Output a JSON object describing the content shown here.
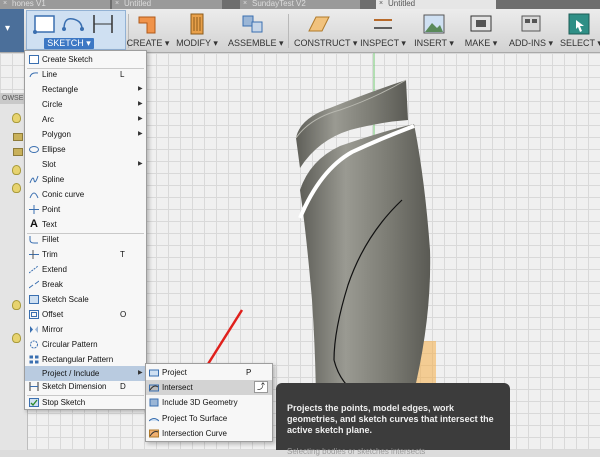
{
  "tabs": [
    {
      "label": "hones V1",
      "active": false
    },
    {
      "label": "Untitled",
      "active": false
    },
    {
      "label": "SundayTest V2",
      "active": false
    },
    {
      "label": "Untitled",
      "active": true
    }
  ],
  "toolbar": {
    "sketch": "SKETCH ▾",
    "create": "CREATE ▾",
    "modify": "MODIFY ▾",
    "assemble": "ASSEMBLE ▾",
    "construct": "CONSTRUCT ▾",
    "inspect": "INSPECT ▾",
    "insert": "INSERT ▾",
    "make": "MAKE ▾",
    "addins": "ADD-INS ▾",
    "select": "SELECT ▾"
  },
  "browser": {
    "header": "OWSER"
  },
  "sketch_menu": [
    {
      "label": "Create Sketch",
      "icon": "create-sketch-icon",
      "shortcut": ""
    },
    {
      "label": "Line",
      "icon": "line-icon",
      "shortcut": "L"
    },
    {
      "label": "Rectangle",
      "icon": "",
      "submenu": true
    },
    {
      "label": "Circle",
      "icon": "",
      "submenu": true
    },
    {
      "label": "Arc",
      "icon": "",
      "submenu": true
    },
    {
      "label": "Polygon",
      "icon": "",
      "submenu": true
    },
    {
      "label": "Ellipse",
      "icon": "ellipse-icon"
    },
    {
      "label": "Slot",
      "icon": "",
      "submenu": true
    },
    {
      "label": "Spline",
      "icon": "spline-icon"
    },
    {
      "label": "Conic curve",
      "icon": "conic-curve-icon"
    },
    {
      "label": "Point",
      "icon": "point-icon"
    },
    {
      "label": "Text",
      "icon": "text-icon"
    },
    {
      "label": "Fillet",
      "icon": "fillet-icon"
    },
    {
      "label": "Trim",
      "icon": "trim-icon",
      "shortcut": "T"
    },
    {
      "label": "Extend",
      "icon": "extend-icon"
    },
    {
      "label": "Break",
      "icon": "break-icon"
    },
    {
      "label": "Sketch Scale",
      "icon": "sketch-scale-icon"
    },
    {
      "label": "Offset",
      "icon": "offset-icon",
      "shortcut": "O"
    },
    {
      "label": "Mirror",
      "icon": "mirror-icon"
    },
    {
      "label": "Circular Pattern",
      "icon": "circular-pattern-icon"
    },
    {
      "label": "Rectangular Pattern",
      "icon": "rectangular-pattern-icon"
    },
    {
      "label": "Project / Include",
      "icon": "",
      "submenu": true
    },
    {
      "label": "Sketch Dimension",
      "icon": "sketch-dimension-icon",
      "shortcut": "D"
    },
    {
      "label": "Stop Sketch",
      "icon": "stop-sketch-icon"
    }
  ],
  "submenu": [
    {
      "label": "Project",
      "shortcut": "P"
    },
    {
      "label": "Intersect",
      "shortcut": ""
    },
    {
      "label": "Include 3D Geometry",
      "shortcut": ""
    },
    {
      "label": "Project To Surface",
      "shortcut": ""
    },
    {
      "label": "Intersection Curve",
      "shortcut": ""
    }
  ],
  "tooltip": {
    "text": "Projects the points, model edges, work geometries, and sketch curves that intersect the active sketch plane.",
    "more": "Selecting bodies or sketches intersects"
  },
  "colors": {
    "accent": "#3d78c4",
    "highlight": "#b9cbe0",
    "model": "#8a8a82"
  }
}
